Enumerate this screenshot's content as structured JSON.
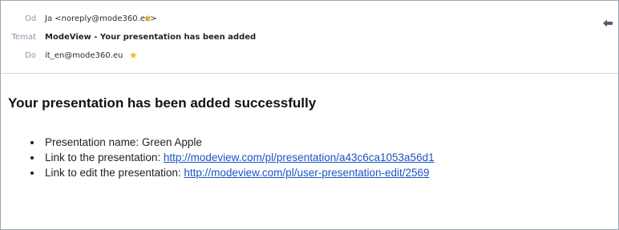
{
  "header": {
    "from_label": "Od",
    "from_value": "Ja <noreply@mode360.eu>",
    "subject_label": "Temat",
    "subject_value": "ModeView - Your presentation has been added",
    "to_label": "Do",
    "to_value": "it_en@mode360.eu"
  },
  "body": {
    "title": "Your presentation has been added successfully",
    "items": [
      {
        "label": "Presentation name: ",
        "value": "Green Apple"
      },
      {
        "label": "Link to the presentation: ",
        "link": "http://modeview.com/pl/presentation/a43c6ca1053a56d1"
      },
      {
        "label": "Link to edit the presentation: ",
        "link": "http://modeview.com/pl/user-presentation-edit/2569"
      }
    ]
  },
  "colors": {
    "link": "#1a55c4",
    "star": "#f2b71b",
    "label": "#8a97a8",
    "border": "#9aa7b6"
  },
  "icons": {
    "star": "star-icon",
    "reply": "reply-arrow-icon"
  }
}
